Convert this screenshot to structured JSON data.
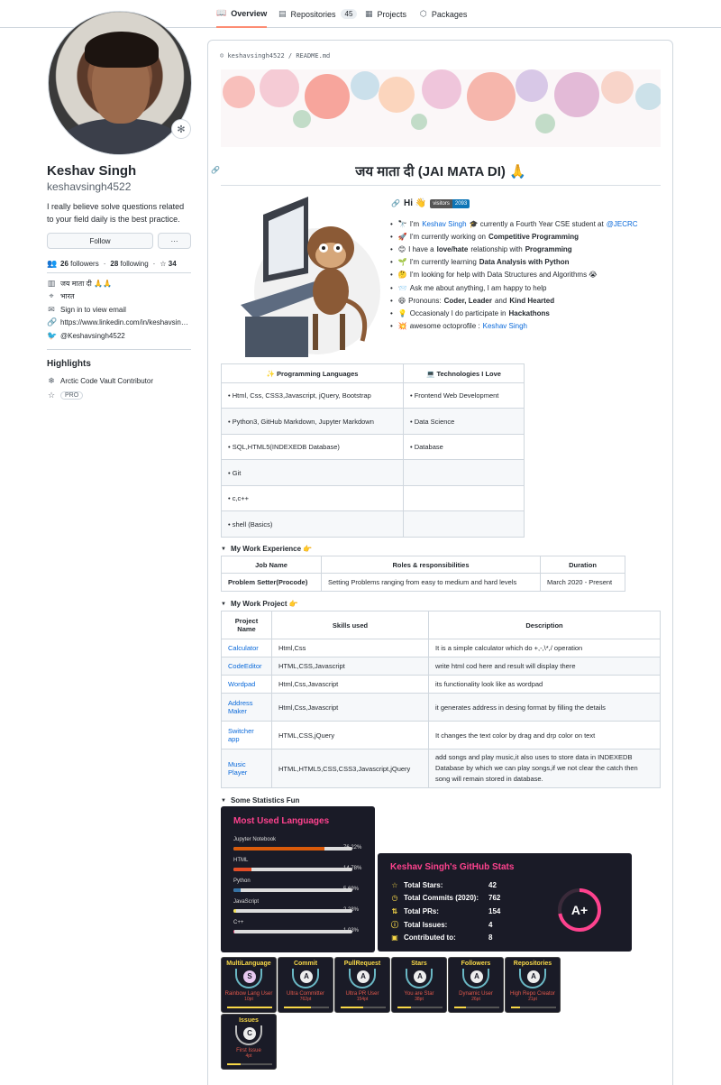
{
  "tabs": [
    {
      "label": "Overview",
      "icon": "book-icon",
      "active": true
    },
    {
      "label": "Repositories",
      "icon": "repo-icon",
      "count": "45"
    },
    {
      "label": "Projects",
      "icon": "project-icon"
    },
    {
      "label": "Packages",
      "icon": "package-icon"
    }
  ],
  "profile": {
    "name": "Keshav Singh",
    "login": "keshavsingh4522",
    "bio": "I really believe solve questions related to your field daily is the best practice.",
    "follow_label": "Follow",
    "more_label": "···",
    "followers_count": "26",
    "followers_label": "followers",
    "following_count": "28",
    "following_label": "following",
    "stars_count": "34",
    "company": "जय माता दी 🙏🙏",
    "location": "भारत",
    "email": "Sign in to view email",
    "website": "https://www.linkedin.com/in/keshavsin…",
    "twitter": "@Keshavsingh4522",
    "highlights_title": "Highlights",
    "highlight_1": "Arctic Code Vault Contributor",
    "highlight_2": "PRO"
  },
  "readme": {
    "breadcrumb_user": "keshavsingh4522",
    "breadcrumb_sep": "/",
    "breadcrumb_file": "README.md",
    "title": "जय माता दी (JAI MATA DI) 🙏",
    "hi": "Hi 👋",
    "visitors_label": "visitors",
    "visitors_count": "2093",
    "bullets": [
      {
        "emoji": "🔭",
        "pre": "I'm ",
        "link": "Keshav Singh",
        "post": " 🎓 currently a Fourth Year CSE student at ",
        "link2": "@JECRC"
      },
      {
        "emoji": "🚀",
        "pre": "I'm currently working on ",
        "bold": "Competitive Programming"
      },
      {
        "emoji": "😊",
        "pre": "I have a ",
        "bold": "love/hate",
        "post": " relationship with ",
        "bold2": "Programming"
      },
      {
        "emoji": "🌱",
        "pre": "I'm currently learning ",
        "bold": "Data Analysis with Python"
      },
      {
        "emoji": "🤔",
        "pre": "I'm looking for help with Data Structures and Algorithms 😭"
      },
      {
        "emoji": "📨",
        "pre": "Ask me about anything, I am happy to help"
      },
      {
        "emoji": "😄",
        "pre": "Pronouns: ",
        "bold": "Coder, Leader",
        "post": " and ",
        "bold2": "Kind Hearted"
      },
      {
        "emoji": "💡",
        "pre": "Occasionaly I do participate in ",
        "bold": "Hackathons"
      },
      {
        "emoji": "💥",
        "pre": "awesome octoprofile : ",
        "link": "Keshav Singh"
      }
    ],
    "skills_table": {
      "headers": [
        "✨ Programming Languages",
        "💻 Technologies I Love"
      ],
      "rows": [
        [
          "Html, Css, CSS3,Javascript, jQuery, Bootstrap",
          "Frontend Web Development"
        ],
        [
          "Python3, GitHub Markdown, Jupyter Markdown",
          "Data Science"
        ],
        [
          "SQL,HTML5(INDEXEDB Database)",
          "Database"
        ],
        [
          "Git",
          ""
        ],
        [
          "c,c++",
          ""
        ],
        [
          "shell (Basics)",
          ""
        ]
      ]
    },
    "experience_title": "My Work Experience 👉",
    "experience_table": {
      "headers": [
        "Job Name",
        "Roles & responsibilities",
        "Duration"
      ],
      "rows": [
        [
          "Problem Setter(Procode)",
          "Setting Problems ranging from easy to medium and hard levels",
          "March 2020 - Present"
        ]
      ]
    },
    "project_title": "My Work Project 👉",
    "project_table": {
      "headers": [
        "Project Name",
        "Skills used",
        "Description"
      ],
      "rows": [
        [
          "Calculator",
          "Html,Css",
          "It is a simple calculator which do +,-,\\*,/ operation"
        ],
        [
          "CodeEditor",
          "HTML,CSS,Javascript",
          "write html cod here and result will display there"
        ],
        [
          "Wordpad",
          "Html,Css,Javascript",
          "its functionality look like as wordpad"
        ],
        [
          "Address Maker",
          "Html,Css,Javascript",
          "it generates address in desing format by filling the details"
        ],
        [
          "Switcher app",
          "HTML,CSS,jQuery",
          "It changes the text color by drag and drp color on text"
        ],
        [
          "Music Player",
          "HTML,HTML5,CSS,CSS3,Javascript,jQuery",
          "add songs and play music,it also uses to store data in INDEXEDB Database by which we can play songs,if we not clear the catch then song will remain stored in database."
        ]
      ]
    },
    "stats_title": "Some Statistics Fun",
    "top_langs": {
      "title": "Most Used Languages",
      "langs": [
        {
          "name": "Jupyter Notebook",
          "pct": "76.22%",
          "value": 76.22,
          "color": "#DA5B0B"
        },
        {
          "name": "HTML",
          "pct": "14.78%",
          "value": 14.78,
          "color": "#e34c26"
        },
        {
          "name": "Python",
          "pct": "5.69%",
          "value": 5.69,
          "color": "#3572A5"
        },
        {
          "name": "JavaScript",
          "pct": "2.28%",
          "value": 2.28,
          "color": "#f1e05a"
        },
        {
          "name": "C++",
          "pct": "1.03%",
          "value": 1.03,
          "color": "#f34b7d"
        }
      ]
    },
    "gh_stats": {
      "title": "Keshav Singh's GitHub Stats",
      "rows": [
        {
          "icon": "☆",
          "label": "Total Stars:",
          "value": "42"
        },
        {
          "icon": "◷",
          "label": "Total Commits (2020):",
          "value": "762"
        },
        {
          "icon": "⇅",
          "label": "Total PRs:",
          "value": "154"
        },
        {
          "icon": "ⓘ",
          "label": "Total Issues:",
          "value": "4"
        },
        {
          "icon": "▣",
          "label": "Contributed to:",
          "value": "8"
        }
      ],
      "rank": "A+",
      "rank_progress": 0.72
    },
    "trophies": [
      {
        "title": "MultiLanguage",
        "rank": "S",
        "label": "Rainbow Lang User",
        "points": "10pt",
        "progress": 1.0
      },
      {
        "title": "Commit",
        "rank": "A",
        "label": "Ultra Committer",
        "points": "762pt",
        "progress": 0.6
      },
      {
        "title": "PullRequest",
        "rank": "A",
        "label": "Ultra PR User",
        "points": "154pt",
        "progress": 0.5
      },
      {
        "title": "Stars",
        "rank": "A",
        "label": "You are Star",
        "points": "38pt",
        "progress": 0.3
      },
      {
        "title": "Followers",
        "rank": "A",
        "label": "Dynamic User",
        "points": "26pt",
        "progress": 0.25
      },
      {
        "title": "Repositories",
        "rank": "A",
        "label": "High Repo Creator",
        "points": "21pt",
        "progress": 0.2
      },
      {
        "title": "Issues",
        "rank": "C",
        "label": "First Issue",
        "points": "4pt",
        "progress": 0.3
      }
    ]
  }
}
